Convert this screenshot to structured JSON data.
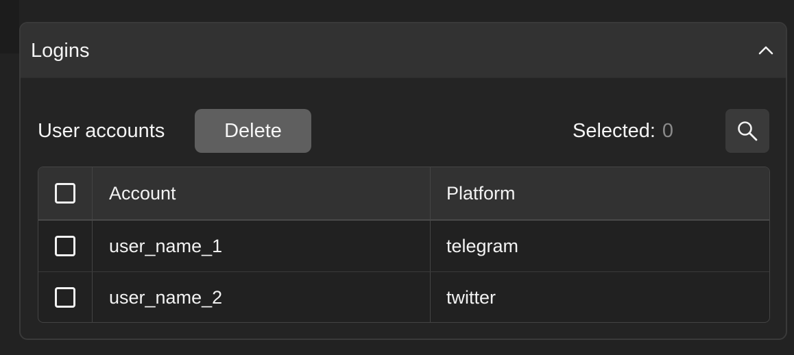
{
  "panel": {
    "title": "Logins",
    "collapse_icon": "chevron-up-icon"
  },
  "toolbar": {
    "label": "User accounts",
    "delete_label": "Delete",
    "selected_label": "Selected:",
    "selected_count": "0",
    "search_icon": "search-icon"
  },
  "table": {
    "columns": [
      "Account",
      "Platform"
    ],
    "rows": [
      {
        "account": "user_name_1",
        "platform": "telegram",
        "checked": false
      },
      {
        "account": "user_name_2",
        "platform": "twitter",
        "checked": false
      }
    ]
  },
  "colors": {
    "background": "#222222",
    "panel_header": "#323232",
    "delete_button": "#5f5f5f",
    "muted_count": "#8a8a8a"
  }
}
